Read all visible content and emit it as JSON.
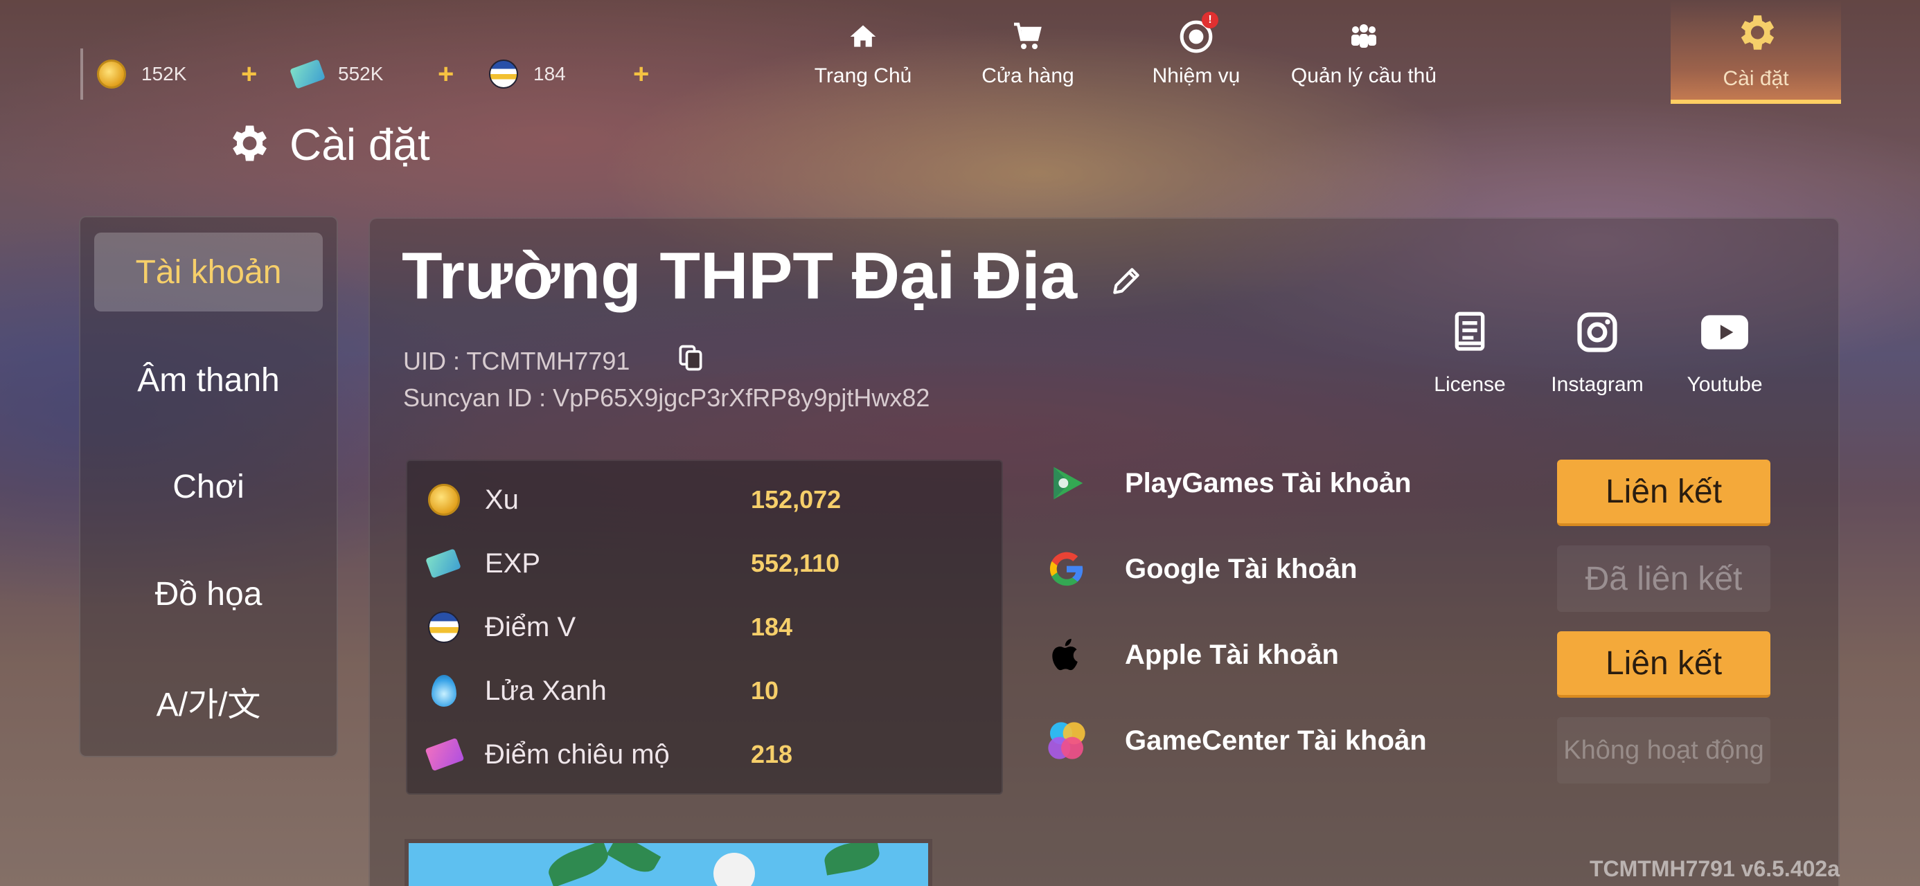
{
  "currencies": [
    {
      "name": "coin",
      "value": "152K"
    },
    {
      "name": "exp-ticket",
      "value": "552K"
    },
    {
      "name": "v-point",
      "value": "184"
    }
  ],
  "nav": {
    "home": "Trang Chủ",
    "shop": "Cửa hàng",
    "missions": "Nhiệm vụ",
    "missions_badge": "!",
    "players": "Quản lý cầu thủ",
    "settings": "Cài đặt"
  },
  "page_title": "Cài đặt",
  "sidebar": {
    "items": [
      {
        "label": "Tài khoản",
        "active": true
      },
      {
        "label": "Âm thanh",
        "active": false
      },
      {
        "label": "Chơi",
        "active": false
      },
      {
        "label": "Đồ họa",
        "active": false
      },
      {
        "label": "A/가/文",
        "active": false
      }
    ]
  },
  "profile": {
    "name": "Trường THPT Đại Địa",
    "uid": "UID : TCMTMH7791",
    "suncyan_id": "Suncyan ID : VpP65X9jgcP3rXfRP8y9pjtHwx82"
  },
  "socials": [
    "License",
    "Instagram",
    "Youtube"
  ],
  "stats": [
    {
      "label": "Xu",
      "value": "152,072"
    },
    {
      "label": "EXP",
      "value": "552,110"
    },
    {
      "label": "Điểm V",
      "value": "184"
    },
    {
      "label": "Lửa Xanh",
      "value": "10"
    },
    {
      "label": "Điểm chiêu mộ",
      "value": "218"
    }
  ],
  "accounts": [
    {
      "label": "PlayGames Tài khoản",
      "button": "Liên kết"
    },
    {
      "label": "Google Tài khoản",
      "button": "Đã liên kết"
    },
    {
      "label": "Apple Tài khoản",
      "button": "Liên kết"
    },
    {
      "label": "GameCenter Tài khoản",
      "button": "Không hoạt động"
    }
  ],
  "version": "TCMTMH7791  v6.5.402a",
  "colors": {
    "accent": "#f6cf6a",
    "button": "#f4a93a"
  }
}
